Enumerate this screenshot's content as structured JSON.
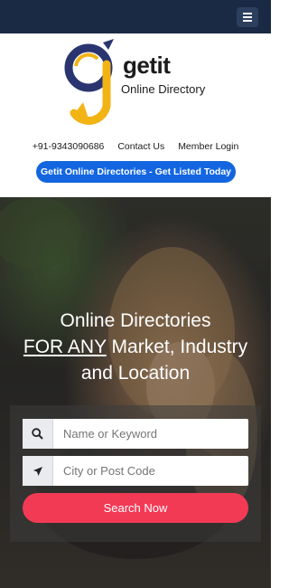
{
  "navbar": {
    "menu_icon": "hamburger-icon",
    "background": "#1a2a45"
  },
  "brand": {
    "name": "getit",
    "tagline": "Online Directory",
    "logo_icon": "getit-logo-icon",
    "colors": {
      "navy": "#2a3570",
      "gold": "#f2b315"
    }
  },
  "contact_bar": {
    "phone": "+91-9343090686",
    "contact_link": "Contact Us",
    "login_link": "Member Login"
  },
  "cta": {
    "label": "Getit Online Directories - Get Listed Today",
    "color": "#1466e0"
  },
  "hero": {
    "line1": "Online Directories",
    "line2_accent": "FOR ANY",
    "line2_rest": " Market, Industry",
    "line3": "and Location"
  },
  "search": {
    "keyword_placeholder": "Name or Keyword",
    "keyword_icon": "search-icon",
    "location_placeholder": "City or Post Code",
    "location_icon": "location-arrow-icon",
    "button_label": "Search Now",
    "button_color": "#f23a55"
  }
}
